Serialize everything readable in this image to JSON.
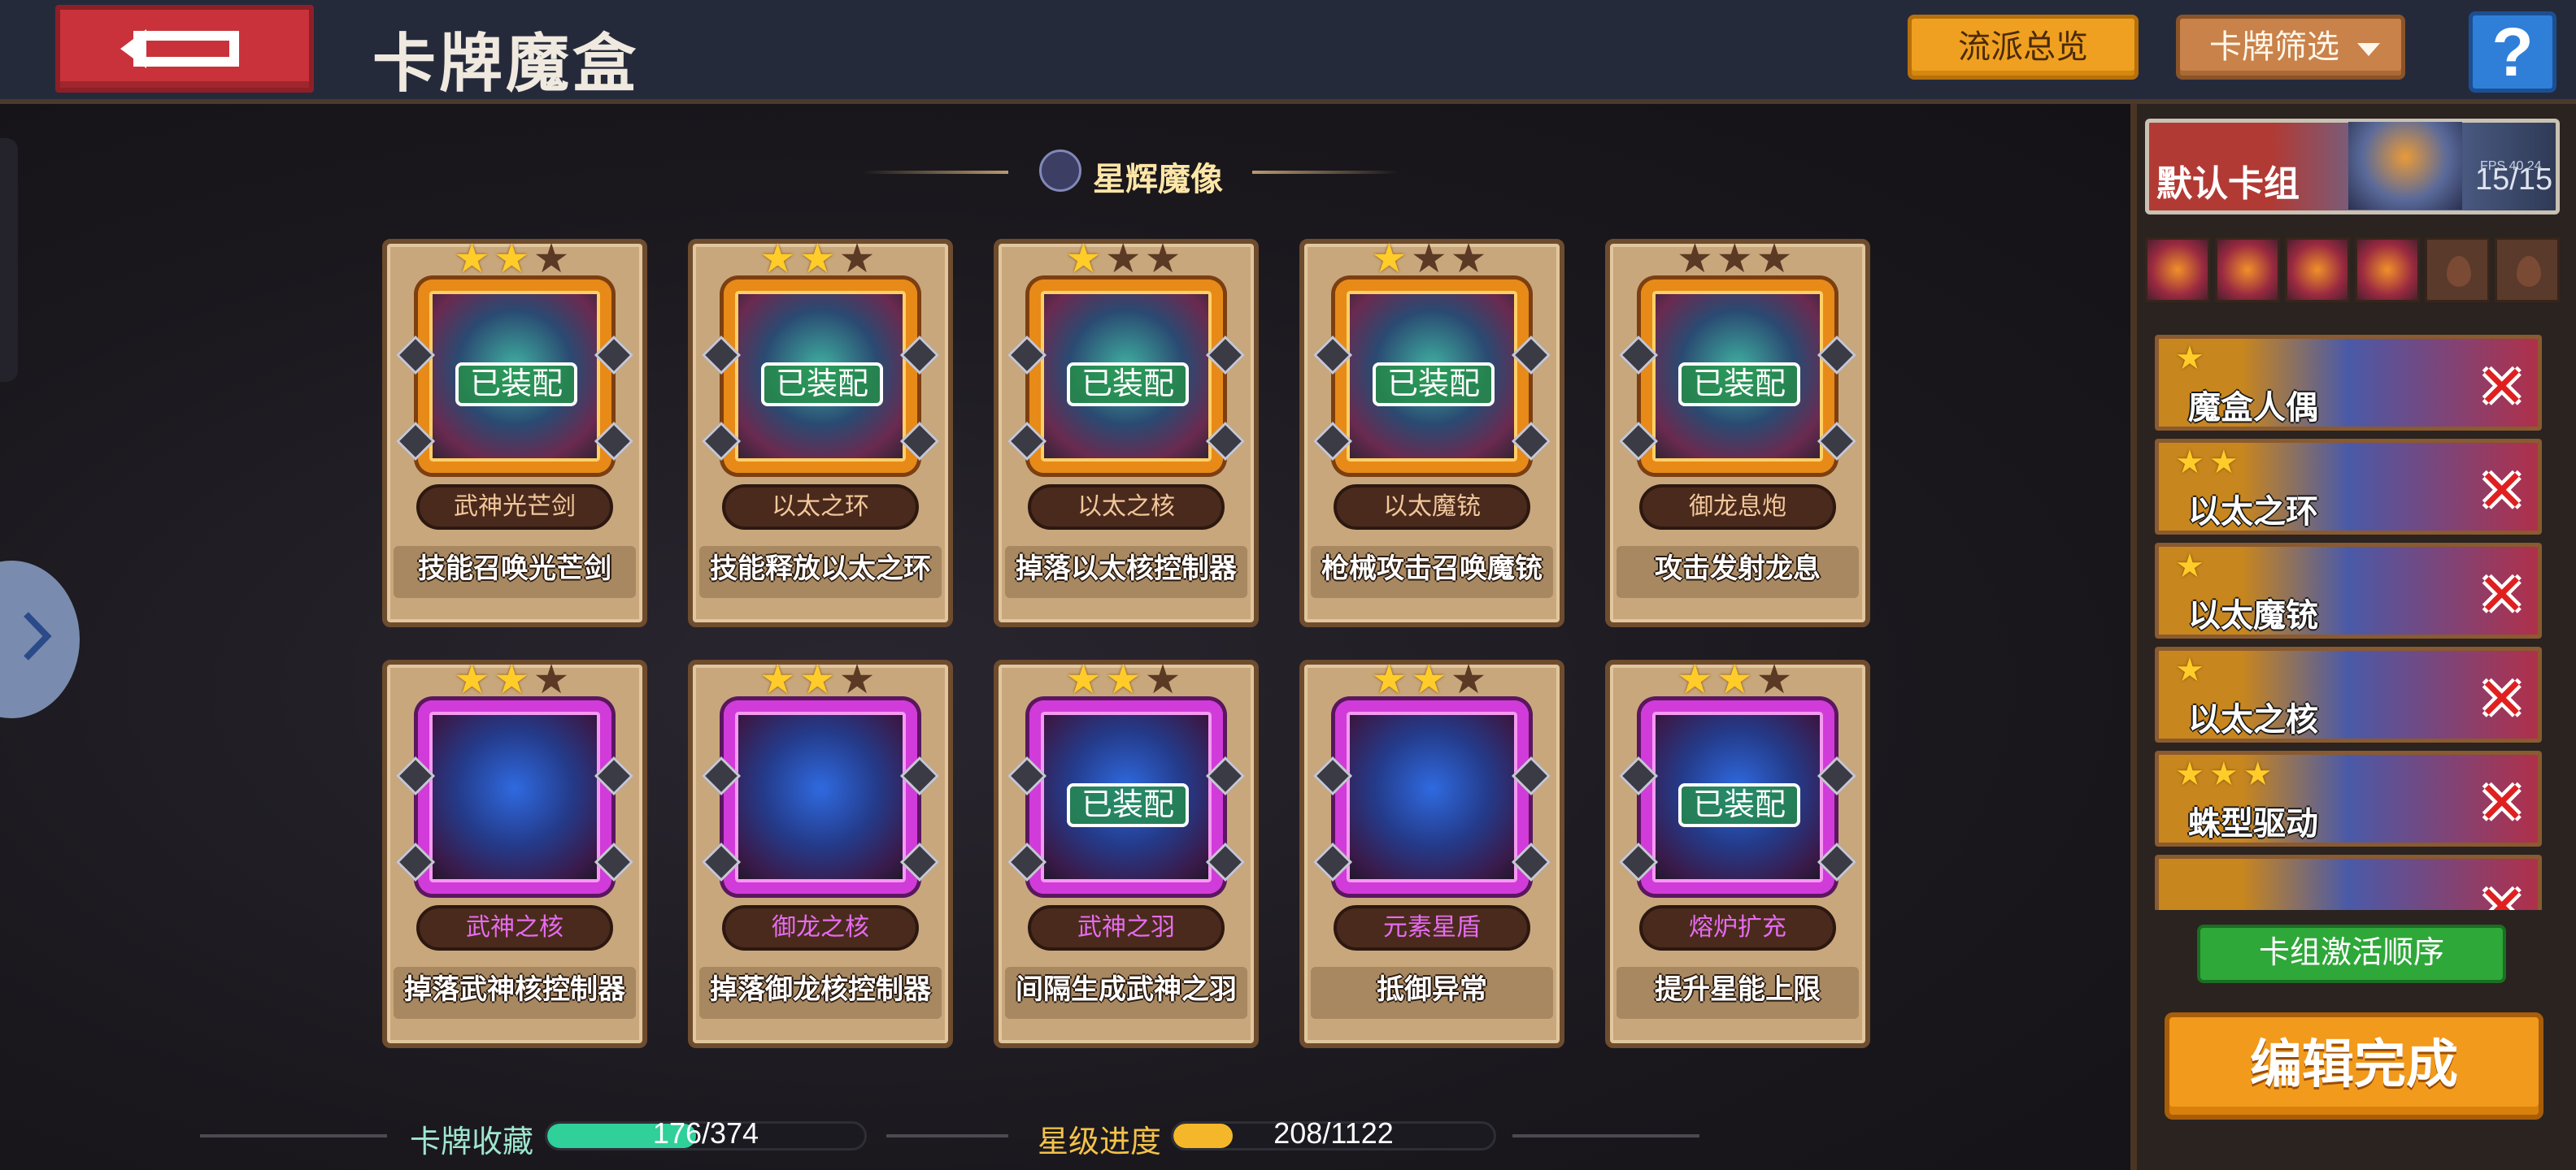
{
  "header": {
    "title": "卡牌魔盒",
    "overview_label": "流派总览",
    "filter_label": "卡牌筛选",
    "help_label": "?"
  },
  "section": {
    "title": "星辉魔像"
  },
  "cards": [
    {
      "name": "武神光芒剑",
      "desc": "技能召唤光芒剑",
      "stars": 2,
      "max_stars": 3,
      "frame": "orange",
      "equipped": true
    },
    {
      "name": "以太之环",
      "desc": "技能释放以太之环",
      "stars": 2,
      "max_stars": 3,
      "frame": "orange",
      "equipped": true
    },
    {
      "name": "以太之核",
      "desc": "掉落以太核控制器",
      "stars": 1,
      "max_stars": 3,
      "frame": "orange",
      "equipped": true
    },
    {
      "name": "以太魔铳",
      "desc": "枪械攻击召唤魔铳",
      "stars": 1,
      "max_stars": 3,
      "frame": "orange",
      "equipped": true
    },
    {
      "name": "御龙息炮",
      "desc": "攻击发射龙息",
      "stars": 0,
      "max_stars": 3,
      "frame": "orange",
      "equipped": true
    },
    {
      "name": "武神之核",
      "desc": "掉落武神核控制器",
      "stars": 2,
      "max_stars": 3,
      "frame": "purple",
      "equipped": false
    },
    {
      "name": "御龙之核",
      "desc": "掉落御龙核控制器",
      "stars": 2,
      "max_stars": 3,
      "frame": "purple",
      "equipped": false
    },
    {
      "name": "武神之羽",
      "desc": "间隔生成武神之羽",
      "stars": 2,
      "max_stars": 3,
      "frame": "purple",
      "equipped": true
    },
    {
      "name": "元素星盾",
      "desc": "抵御异常",
      "stars": 2,
      "max_stars": 3,
      "frame": "purple",
      "equipped": false
    },
    {
      "name": "熔炉扩充",
      "desc": "提升星能上限",
      "stars": 2,
      "max_stars": 3,
      "frame": "purple",
      "equipped": true
    }
  ],
  "equipped_label": "已装配",
  "stats": {
    "collection_label": "卡牌收藏",
    "collection_value": "176/374",
    "collection_fraction": 0.47,
    "star_label": "星级进度",
    "star_value": "208/1122",
    "star_fraction": 0.185
  },
  "deck": {
    "name": "默认卡组",
    "count": "15/15",
    "corner_text": "FPS 40.24",
    "slots_filled": 4,
    "slots_total": 6,
    "items": [
      {
        "name": "魔盒人偶",
        "stars": 1
      },
      {
        "name": "以太之环",
        "stars": 2
      },
      {
        "name": "以太魔铳",
        "stars": 1
      },
      {
        "name": "以太之核",
        "stars": 1
      },
      {
        "name": "蛛型驱动",
        "stars": 3
      },
      {
        "name": "",
        "stars": 0
      }
    ],
    "activation_label": "卡组激活顺序",
    "done_label": "编辑完成"
  },
  "colors": {
    "accent_orange": "#f0a020",
    "equipped_green": "#2fa83a",
    "star_gold": "#ffcc2a",
    "remove_red": "#e02020"
  },
  "icons": [
    "back-arrow-icon",
    "help-icon",
    "chevron-down-icon",
    "chevron-right-icon",
    "star-icon",
    "remove-icon",
    "golem-emblem-icon"
  ]
}
